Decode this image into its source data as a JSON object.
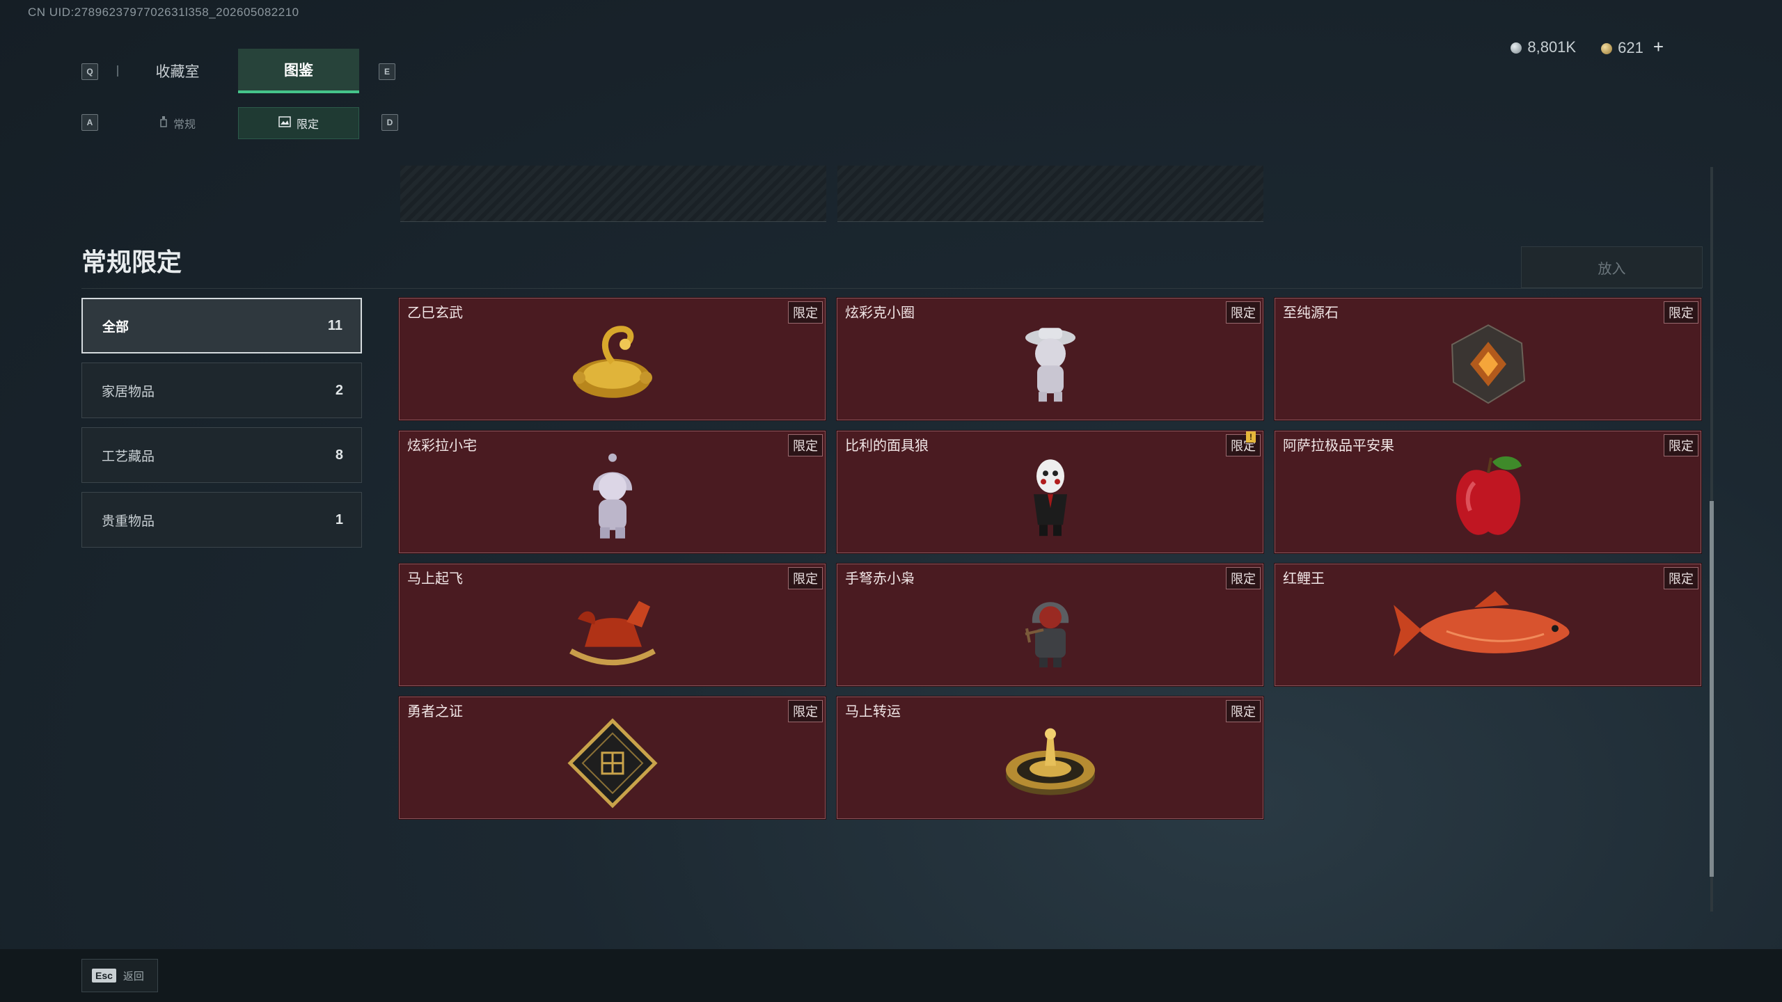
{
  "uid": "CN UID:2789623797702631l358_202605082210",
  "keys": {
    "q": "Q",
    "e": "E",
    "a": "A",
    "d": "D",
    "esc": "Esc"
  },
  "tabs": {
    "collection_room": "收藏室",
    "catalog": "图鉴"
  },
  "subtabs": {
    "regular": "常规",
    "limited": "限定"
  },
  "currency": {
    "silver": "8,801K",
    "gold": "621"
  },
  "section_title": "常规限定",
  "place_button": "放入",
  "categories": [
    {
      "label": "全部",
      "count": "11"
    },
    {
      "label": "家居物品",
      "count": "2"
    },
    {
      "label": "工艺藏品",
      "count": "8"
    },
    {
      "label": "贵重物品",
      "count": "1"
    }
  ],
  "items": [
    {
      "name": "乙巳玄武",
      "tag": "限定",
      "icon": "golden-turtle-snake-icon"
    },
    {
      "name": "炫彩克小圈",
      "tag": "限定",
      "icon": "silver-figure-hat-icon"
    },
    {
      "name": "至纯源石",
      "tag": "限定",
      "icon": "source-crystal-icon"
    },
    {
      "name": "炫彩拉小宅",
      "tag": "限定",
      "icon": "hooded-figure-icon"
    },
    {
      "name": "比利的面具狼",
      "tag": "限定",
      "icon": "masked-puppet-icon",
      "alert": "!"
    },
    {
      "name": "阿萨拉极品平安果",
      "tag": "限定",
      "icon": "red-apple-icon"
    },
    {
      "name": "马上起飞",
      "tag": "限定",
      "icon": "rocking-horse-icon"
    },
    {
      "name": "手弩赤小枭",
      "tag": "限定",
      "icon": "hooded-crossbow-figure-icon"
    },
    {
      "name": "红鲤王",
      "tag": "限定",
      "icon": "red-carp-icon"
    },
    {
      "name": "勇者之证",
      "tag": "限定",
      "icon": "brave-token-icon"
    },
    {
      "name": "马上转运",
      "tag": "限定",
      "icon": "golden-turntable-icon"
    }
  ],
  "footer": {
    "back_label": "返回"
  },
  "colors": {
    "accent": "#45c48a",
    "card_bg": "#4a1b21",
    "card_border": "#8a5258"
  }
}
